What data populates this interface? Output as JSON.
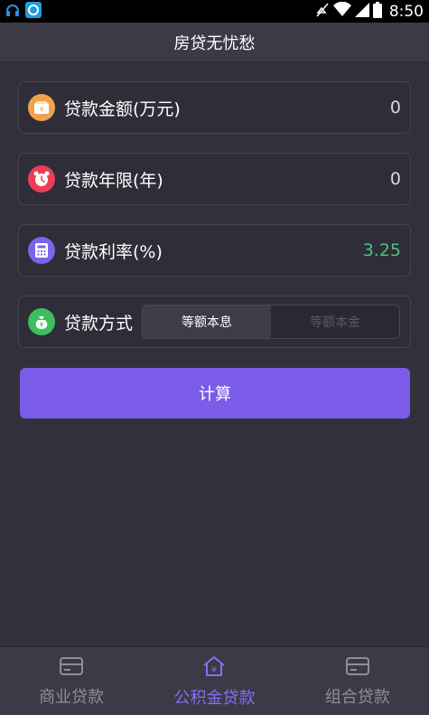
{
  "status_bar": {
    "time": "8:50",
    "icons": [
      "headset-icon",
      "app-icon",
      "mute-icon",
      "wifi-icon",
      "signal-icon",
      "battery-icon"
    ]
  },
  "header": {
    "title": "房贷无忧愁"
  },
  "form": {
    "amount": {
      "label": "贷款金额(万元)",
      "value": "0",
      "icon": "wallet-icon",
      "color": "#f0a24e"
    },
    "years": {
      "label": "贷款年限(年)",
      "value": "0",
      "icon": "alarm-clock-icon",
      "color": "#ee3d55"
    },
    "rate": {
      "label": "贷款利率(%)",
      "value": "3.25",
      "icon": "calculator-icon",
      "color": "#7c64e6",
      "value_color": "#4fc37a"
    },
    "method": {
      "label": "贷款方式",
      "icon": "money-bag-icon",
      "color": "#3dbd5f",
      "options": [
        "等额本息",
        "等额本金"
      ],
      "selected": "等额本息"
    }
  },
  "calculate_label": "计算",
  "tabs": [
    {
      "label": "商业贷款",
      "icon": "card-icon",
      "active": false
    },
    {
      "label": "公积金贷款",
      "icon": "house-yuan-icon",
      "active": true
    },
    {
      "label": "组合贷款",
      "icon": "card-icon",
      "active": false
    }
  ],
  "colors": {
    "accent": "#7b5ce8",
    "background": "#31303c",
    "rate_value": "#4fc37a"
  }
}
